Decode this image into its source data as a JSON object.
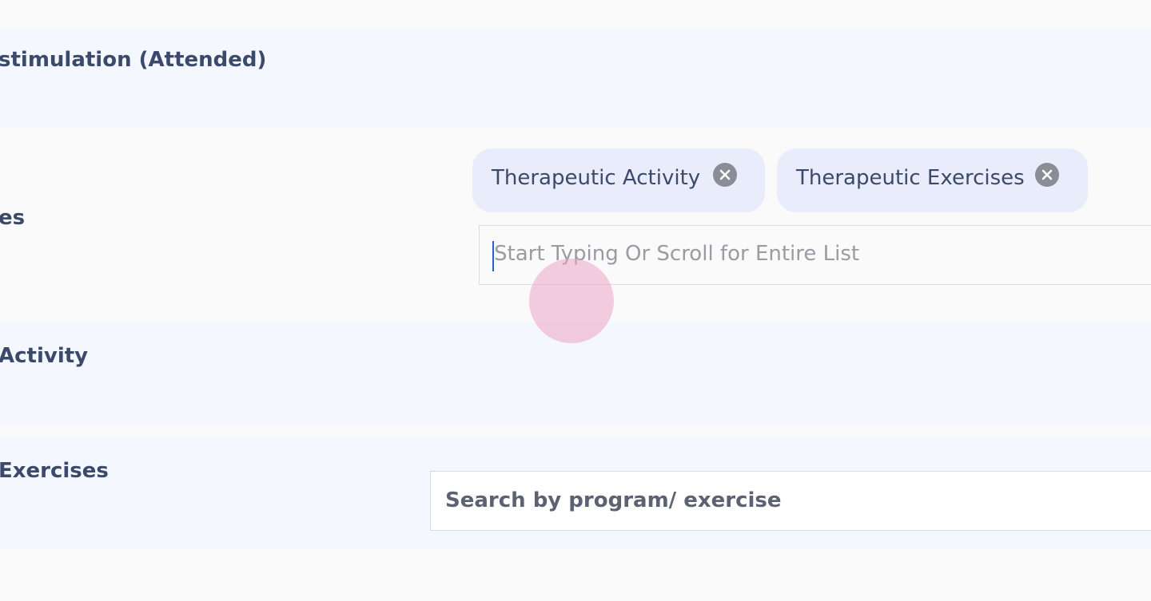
{
  "rows": {
    "row1_label": "stimulation (Attended)",
    "row2_label": "es",
    "row3_label": "Activity",
    "row4_label": "Exercises"
  },
  "selected_chips": [
    {
      "label": "Therapeutic Activity",
      "remove_icon": "close-circle-icon"
    },
    {
      "label": "Therapeutic Exercises",
      "remove_icon": "close-circle-icon"
    }
  ],
  "combo_input": {
    "placeholder": "Start Typing Or Scroll for Entire List",
    "value": ""
  },
  "search_input": {
    "placeholder": "Search by program/ exercise",
    "value": ""
  },
  "colors": {
    "label_text": "#3b4a6b",
    "chip_bg": "#e9ecfa",
    "row_tint": "#f4f7fd",
    "caret": "#2f5ccf",
    "touch_indicator": "#eca0c4"
  }
}
